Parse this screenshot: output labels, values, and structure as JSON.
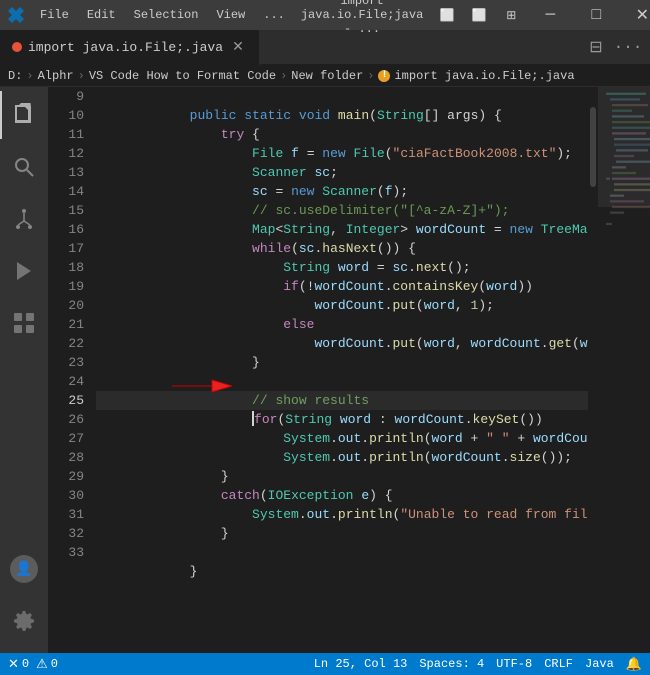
{
  "titleBar": {
    "menuItems": [
      "File",
      "Edit",
      "Selection",
      "View",
      "..."
    ],
    "title": "import java.io.File;java - ...",
    "windowControls": {
      "minimize": "─",
      "maximize": "□",
      "close": "✕"
    }
  },
  "tabs": {
    "active": {
      "label": "import java.io.File;.java",
      "closeLabel": "✕"
    }
  },
  "breadcrumb": {
    "items": [
      "D:",
      "Alphr",
      "VS Code How to Format Code",
      "New folder",
      "import java.io.File;.java"
    ]
  },
  "activityBar": {
    "items": [
      {
        "name": "explorer",
        "icon": "⎘"
      },
      {
        "name": "search",
        "icon": "🔍"
      },
      {
        "name": "source-control",
        "icon": "⎇"
      },
      {
        "name": "run",
        "icon": "▶"
      },
      {
        "name": "extensions",
        "icon": "⊞"
      }
    ]
  },
  "editor": {
    "lines": [
      {
        "num": 9,
        "code": "    public static void main(String[] args) {",
        "active": false
      },
      {
        "num": 10,
        "code": "        try {",
        "active": false
      },
      {
        "num": 11,
        "code": "            File f = new File(\"ciaFactBook2008.txt\");",
        "active": false
      },
      {
        "num": 12,
        "code": "            Scanner sc;",
        "active": false
      },
      {
        "num": 13,
        "code": "            sc = new Scanner(f);",
        "active": false
      },
      {
        "num": 14,
        "code": "            // sc.useDelimiter(\"[^a-zA-Z]+\");",
        "active": false
      },
      {
        "num": 15,
        "code": "            Map<String, Integer> wordCount = new TreeMap<Str",
        "active": false
      },
      {
        "num": 16,
        "code": "            while(sc.hasNext()) {",
        "active": false
      },
      {
        "num": 17,
        "code": "                String word = sc.next();",
        "active": false
      },
      {
        "num": 18,
        "code": "                if(!wordCount.containsKey(word))",
        "active": false
      },
      {
        "num": 19,
        "code": "                    wordCount.put(word, 1);",
        "active": false
      },
      {
        "num": 20,
        "code": "                else",
        "active": false
      },
      {
        "num": 21,
        "code": "                    wordCount.put(word, wordCount.get(word)",
        "active": false
      },
      {
        "num": 22,
        "code": "            }",
        "active": false
      },
      {
        "num": 23,
        "code": "",
        "active": false
      },
      {
        "num": 24,
        "code": "            // show results",
        "active": false
      },
      {
        "num": 25,
        "code": "            for(String word : wordCount.keySet())",
        "active": true
      },
      {
        "num": 26,
        "code": "                System.out.println(word + \" \" + wordCount.ge",
        "active": false
      },
      {
        "num": 27,
        "code": "                System.out.println(wordCount.size());",
        "active": false
      },
      {
        "num": 28,
        "code": "        }",
        "active": false
      },
      {
        "num": 29,
        "code": "        catch(IOException e) {",
        "active": false
      },
      {
        "num": 30,
        "code": "            System.out.println(\"Unable to read from file.\");",
        "active": false
      },
      {
        "num": 31,
        "code": "        }",
        "active": false
      },
      {
        "num": 32,
        "code": "",
        "active": false
      },
      {
        "num": 33,
        "code": "    }",
        "active": false
      }
    ],
    "cursor": {
      "line": 25,
      "col": 13
    }
  },
  "statusBar": {
    "errors": "0",
    "warnings": "0",
    "position": "Ln 25, Col 13",
    "spaces": "Spaces: 4",
    "encoding": "UTF-8",
    "lineEnding": "CRLF",
    "language": "Java"
  }
}
